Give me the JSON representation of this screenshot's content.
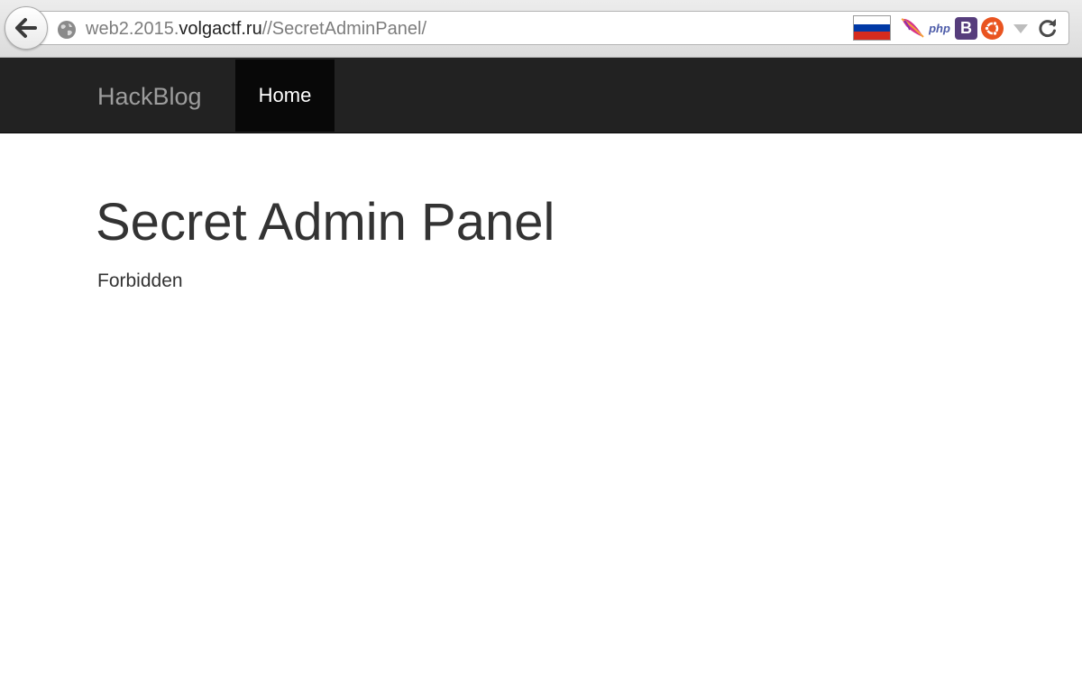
{
  "browser": {
    "url_prefix": "web2.2015.",
    "url_domain": "volgactf.ru",
    "url_path": "//SecretAdminPanel/",
    "extensions": {
      "php_label": "php",
      "bootstrap_label": "B"
    },
    "icons": [
      "back-arrow-icon",
      "globe-icon",
      "russia-flag-icon",
      "feather-icon",
      "php-icon",
      "bootstrap-icon",
      "ubuntu-icon",
      "dropdown-arrow-icon",
      "reload-icon"
    ]
  },
  "navbar": {
    "brand": "HackBlog",
    "items": [
      {
        "label": "Home",
        "active": true
      }
    ],
    "background": "#222222",
    "active_background": "#080808"
  },
  "main": {
    "title": "Secret Admin Panel",
    "text": "Forbidden"
  }
}
